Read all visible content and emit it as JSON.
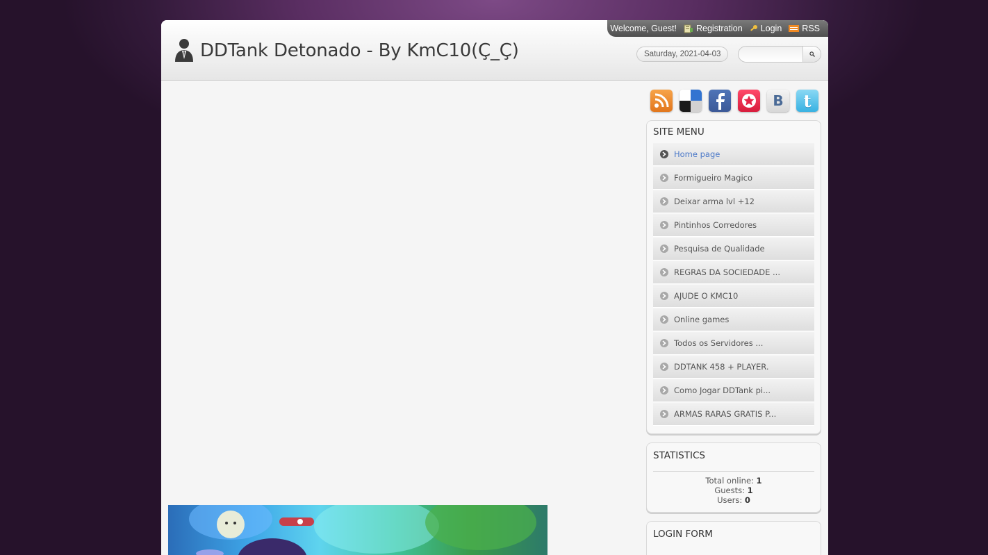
{
  "header": {
    "site_title": "DDTank Detonado - By KmC10(Ç_Ç)",
    "date": "Saturday, 2021-04-03",
    "search_placeholder": ""
  },
  "userbar": {
    "welcome": "Welcome, Guest!",
    "registration": "Registration",
    "login": "Login",
    "rss": "RSS"
  },
  "social_icons": [
    "rss-icon",
    "delicious-icon",
    "facebook-icon",
    "favorites-icon",
    "vkontakte-icon",
    "twitter-icon"
  ],
  "site_menu": {
    "title": "SITE MENU",
    "items": [
      {
        "label": "Home page",
        "active": true
      },
      {
        "label": "Formigueiro Magico"
      },
      {
        "label": "Deixar arma lvl +12"
      },
      {
        "label": "Pintinhos Corredores"
      },
      {
        "label": "Pesquisa de Qualidade"
      },
      {
        "label": "REGRAS DA SOCIEDADE ..."
      },
      {
        "label": "AJUDE O KMC10"
      },
      {
        "label": "Online games"
      },
      {
        "label": "Todos os Servidores ..."
      },
      {
        "label": "DDTANK 458 + PLAYER."
      },
      {
        "label": "Como Jogar DDTank pi..."
      },
      {
        "label": "ARMAS RARAS GRATIS P..."
      }
    ]
  },
  "statistics": {
    "title": "STATISTICS",
    "total_online_label": "Total online:",
    "total_online": "1",
    "guests_label": "Guests:",
    "guests": "1",
    "users_label": "Users:",
    "users": "0"
  },
  "login_form": {
    "title": "LOGIN FORM"
  },
  "colors": {
    "background": "#2a1430",
    "active_link": "#4a78c8",
    "userbar": "#5a5a5a"
  }
}
